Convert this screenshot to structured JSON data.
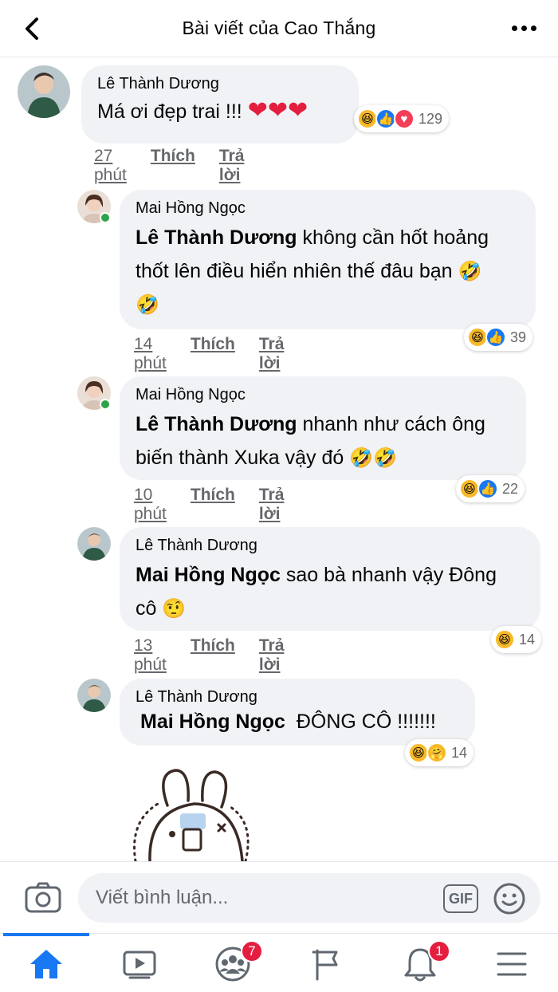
{
  "header": {
    "title": "Bài viết của Cao Thắng"
  },
  "comments": [
    {
      "author": "Lê Thành Dương",
      "text": "Má ơi đẹp trai !!!",
      "hearts": "❤❤❤",
      "reactions": [
        "haha",
        "like",
        "love"
      ],
      "reaction_count": "129",
      "time": "27 phút",
      "like_label": "Thích",
      "reply_label": "Trả lời"
    },
    {
      "author": "Mai Hồng Ngọc",
      "mention": "Lê Thành Dương",
      "text_line1": "không cần hốt hoảng",
      "text_line2": "thốt lên điều hiển nhiên thế đâu bạn",
      "emoji_a": "🤣",
      "emoji_b": "🤣",
      "reactions": [
        "haha",
        "like"
      ],
      "reaction_count": "39",
      "time": "14 phút",
      "like_label": "Thích",
      "reply_label": "Trả lời"
    },
    {
      "author": "Mai Hồng Ngọc",
      "mention": "Lê Thành Dương",
      "text_line1": "nhanh như cách ông",
      "text_line2": "biến thành Xuka vậy đó",
      "emoji": "🤣🤣",
      "reactions": [
        "haha",
        "like"
      ],
      "reaction_count": "22",
      "time": "10 phút",
      "like_label": "Thích",
      "reply_label": "Trả lời"
    },
    {
      "author": "Lê Thành Dương",
      "mention": "Mai Hồng Ngọc",
      "text_line1": "sao bà nhanh vậy Đông",
      "text_line2": "cô",
      "emoji": "🤨",
      "reactions": [
        "haha"
      ],
      "reaction_count": "14",
      "time": "13 phút",
      "like_label": "Thích",
      "reply_label": "Trả lời"
    },
    {
      "author": "Lê Thành Dương",
      "mention": "Mai Hồng Ngọc",
      "text": "ĐÔNG CÔ !!!!!!!",
      "reactions": [
        "haha",
        "care"
      ],
      "reaction_count": "14"
    }
  ],
  "composer": {
    "placeholder": "Viết bình luận...",
    "gif_label": "GIF"
  },
  "nav": {
    "groups_badge": "7",
    "notifications_badge": "1"
  },
  "colors": {
    "accent": "#1877f2",
    "bubble": "#f0f2f5",
    "badge": "#e41e3f",
    "online": "#31a24c"
  }
}
